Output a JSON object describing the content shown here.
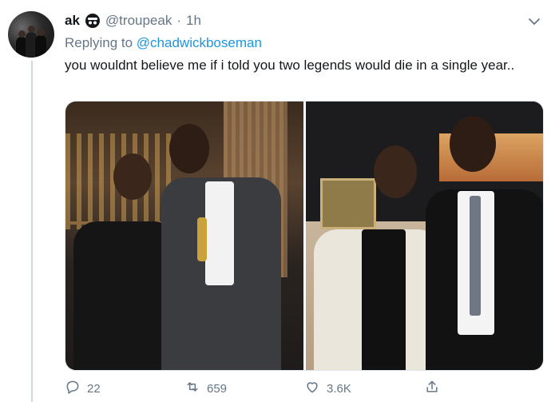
{
  "tweet": {
    "author_name": "ak",
    "author_handle": "@troupeak",
    "separator": "·",
    "time": "1h",
    "reply_prefix": "Replying to",
    "reply_to": "@chadwickboseman",
    "text": "you wouldnt believe me if i told you two legends would die in a single year..",
    "badge_icon": "incognito-icon",
    "menu_icon": "chevron-down-icon"
  },
  "actions": {
    "reply_count": "22",
    "retweet_count": "659",
    "like_count": "3.6K",
    "reply_icon": "reply-icon",
    "retweet_icon": "retweet-icon",
    "like_icon": "heart-icon",
    "share_icon": "share-icon"
  },
  "colors": {
    "link": "#1b95e0",
    "secondary_text": "#657786",
    "primary_text": "#14171a",
    "thread_line": "#cfd9de"
  }
}
